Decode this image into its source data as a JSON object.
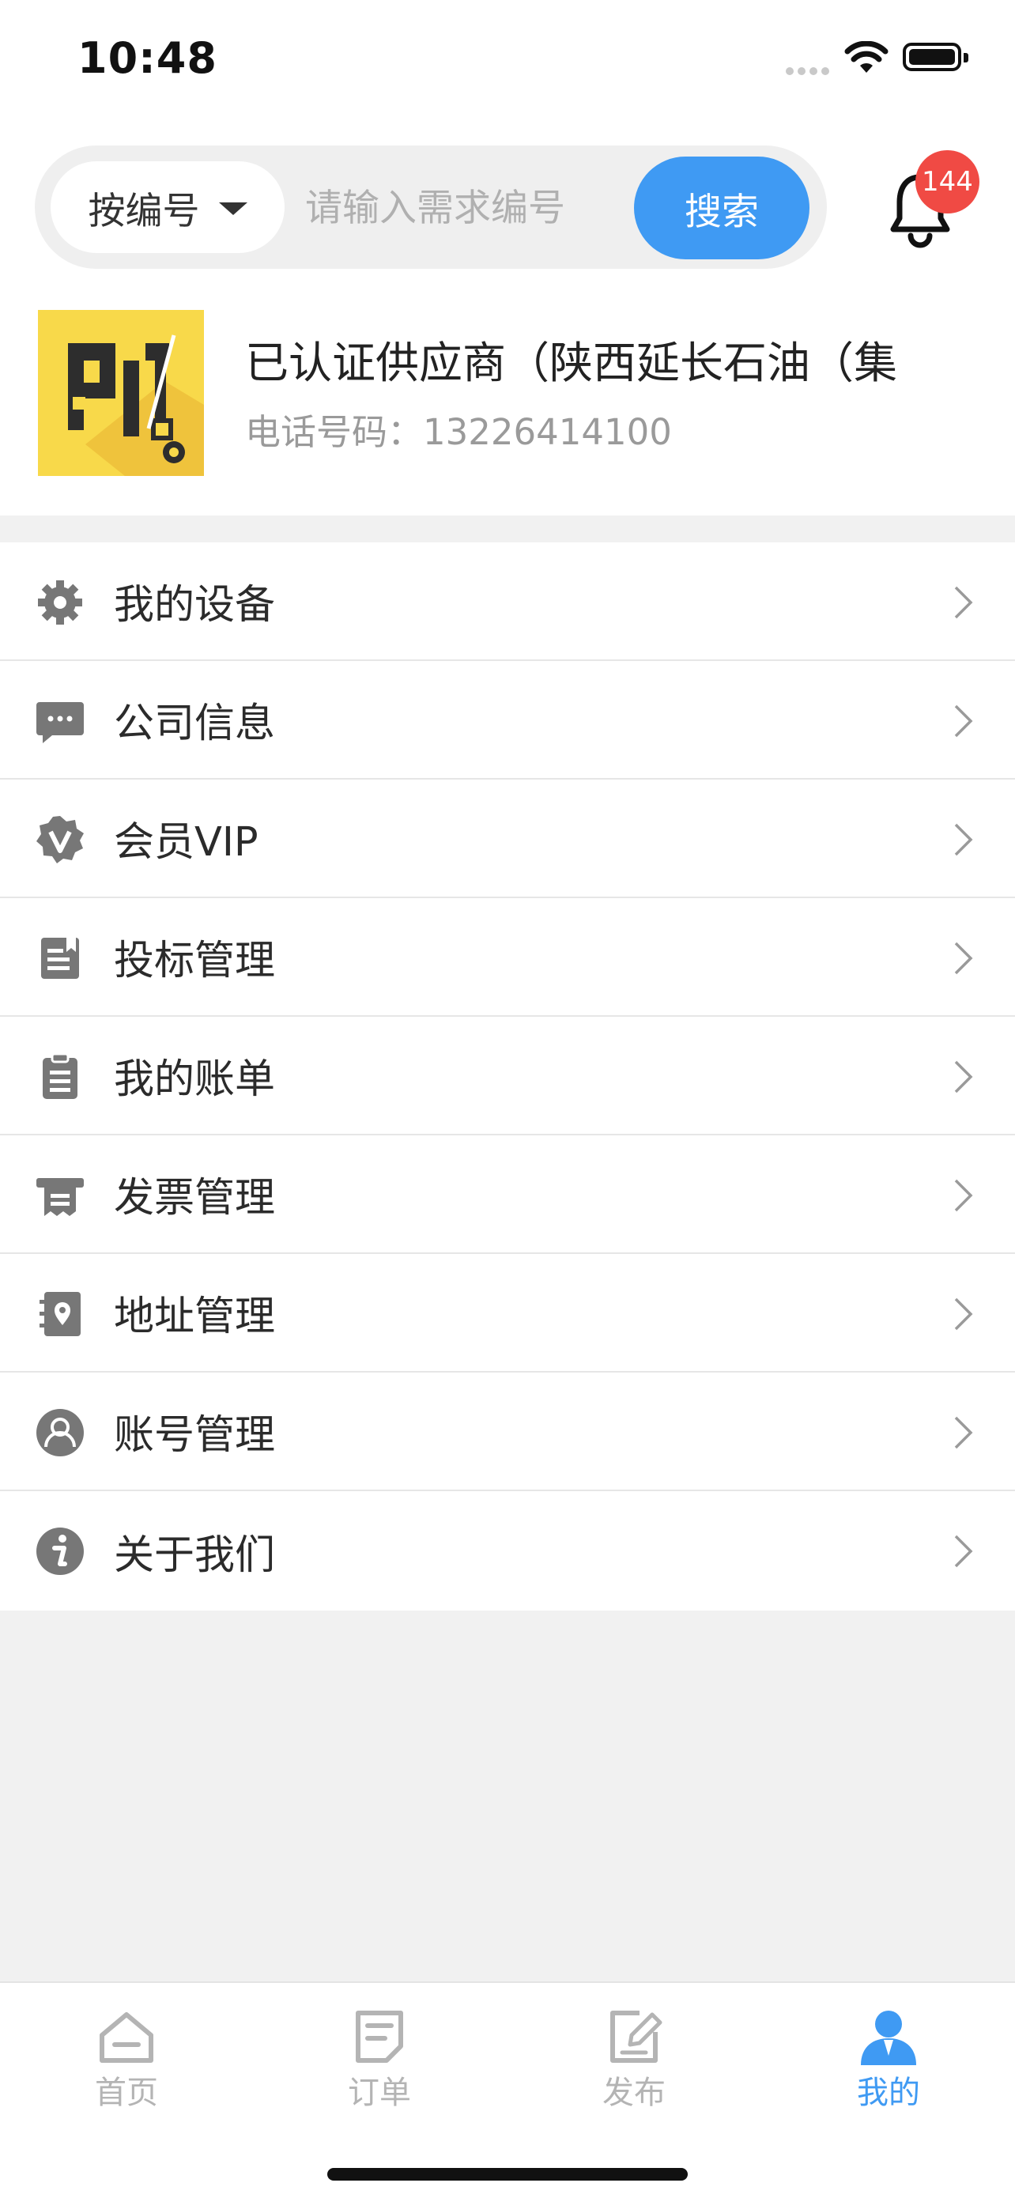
{
  "status_bar": {
    "time": "10:48"
  },
  "search": {
    "filter_label": "按编号",
    "placeholder": "请输入需求编号",
    "button_label": "搜索"
  },
  "notifications": {
    "count": "144"
  },
  "profile": {
    "company_name": "已认证供应商（陕西延长石油（集",
    "phone": "电话号码：13226414100"
  },
  "menu": {
    "items": [
      {
        "label": "我的设备",
        "icon": "gear-icon"
      },
      {
        "label": "公司信息",
        "icon": "chat-bubble-icon"
      },
      {
        "label": "会员VIP",
        "icon": "vip-badge-icon"
      },
      {
        "label": "投标管理",
        "icon": "bid-document-icon"
      },
      {
        "label": "我的账单",
        "icon": "clipboard-icon"
      },
      {
        "label": "发票管理",
        "icon": "invoice-icon"
      },
      {
        "label": "地址管理",
        "icon": "address-book-icon"
      },
      {
        "label": "账号管理",
        "icon": "user-circle-icon"
      },
      {
        "label": "关于我们",
        "icon": "info-icon"
      }
    ]
  },
  "tabbar": {
    "tabs": [
      {
        "label": "首页",
        "icon": "home-icon"
      },
      {
        "label": "订单",
        "icon": "order-icon"
      },
      {
        "label": "发布",
        "icon": "publish-icon"
      },
      {
        "label": "我的",
        "icon": "profile-icon",
        "active": true
      }
    ]
  },
  "colors": {
    "accent": "#3f9af3",
    "badge": "#f04a44",
    "avatar_bg": "#f8d94a"
  }
}
